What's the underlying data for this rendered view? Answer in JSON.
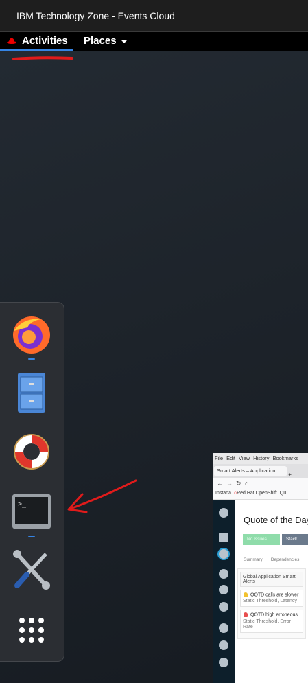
{
  "window_title": "IBM Technology Zone - Events Cloud",
  "topbar": {
    "activities": "Activities",
    "places": "Places"
  },
  "dash": [
    {
      "name": "firefox"
    },
    {
      "name": "files"
    },
    {
      "name": "help"
    },
    {
      "name": "terminal"
    },
    {
      "name": "settings"
    },
    {
      "name": "show-apps"
    }
  ],
  "preview": {
    "menu": [
      "File",
      "Edit",
      "View",
      "History",
      "Bookmarks"
    ],
    "tab": "Smart Alerts – Application",
    "bookmarks": [
      "Instana",
      "Red Hat OpenShift",
      "Qu"
    ],
    "title": "Quote of the Day",
    "no_issues": "No Issues",
    "stack": "Stack",
    "tabs": [
      "Summary",
      "Dependencies"
    ],
    "card_header": "Global Application Smart Alerts",
    "alerts": [
      {
        "title": "QOTD calls are slower",
        "sub": "Static Threshold, Latency",
        "color": "#f2c230"
      },
      {
        "title": "QOTD high erroneous",
        "sub": "Static Threshold, Error Rate",
        "color": "#e85050"
      }
    ]
  },
  "colors": {
    "accent": "#3584e4",
    "annotation": "#e01b1b"
  }
}
